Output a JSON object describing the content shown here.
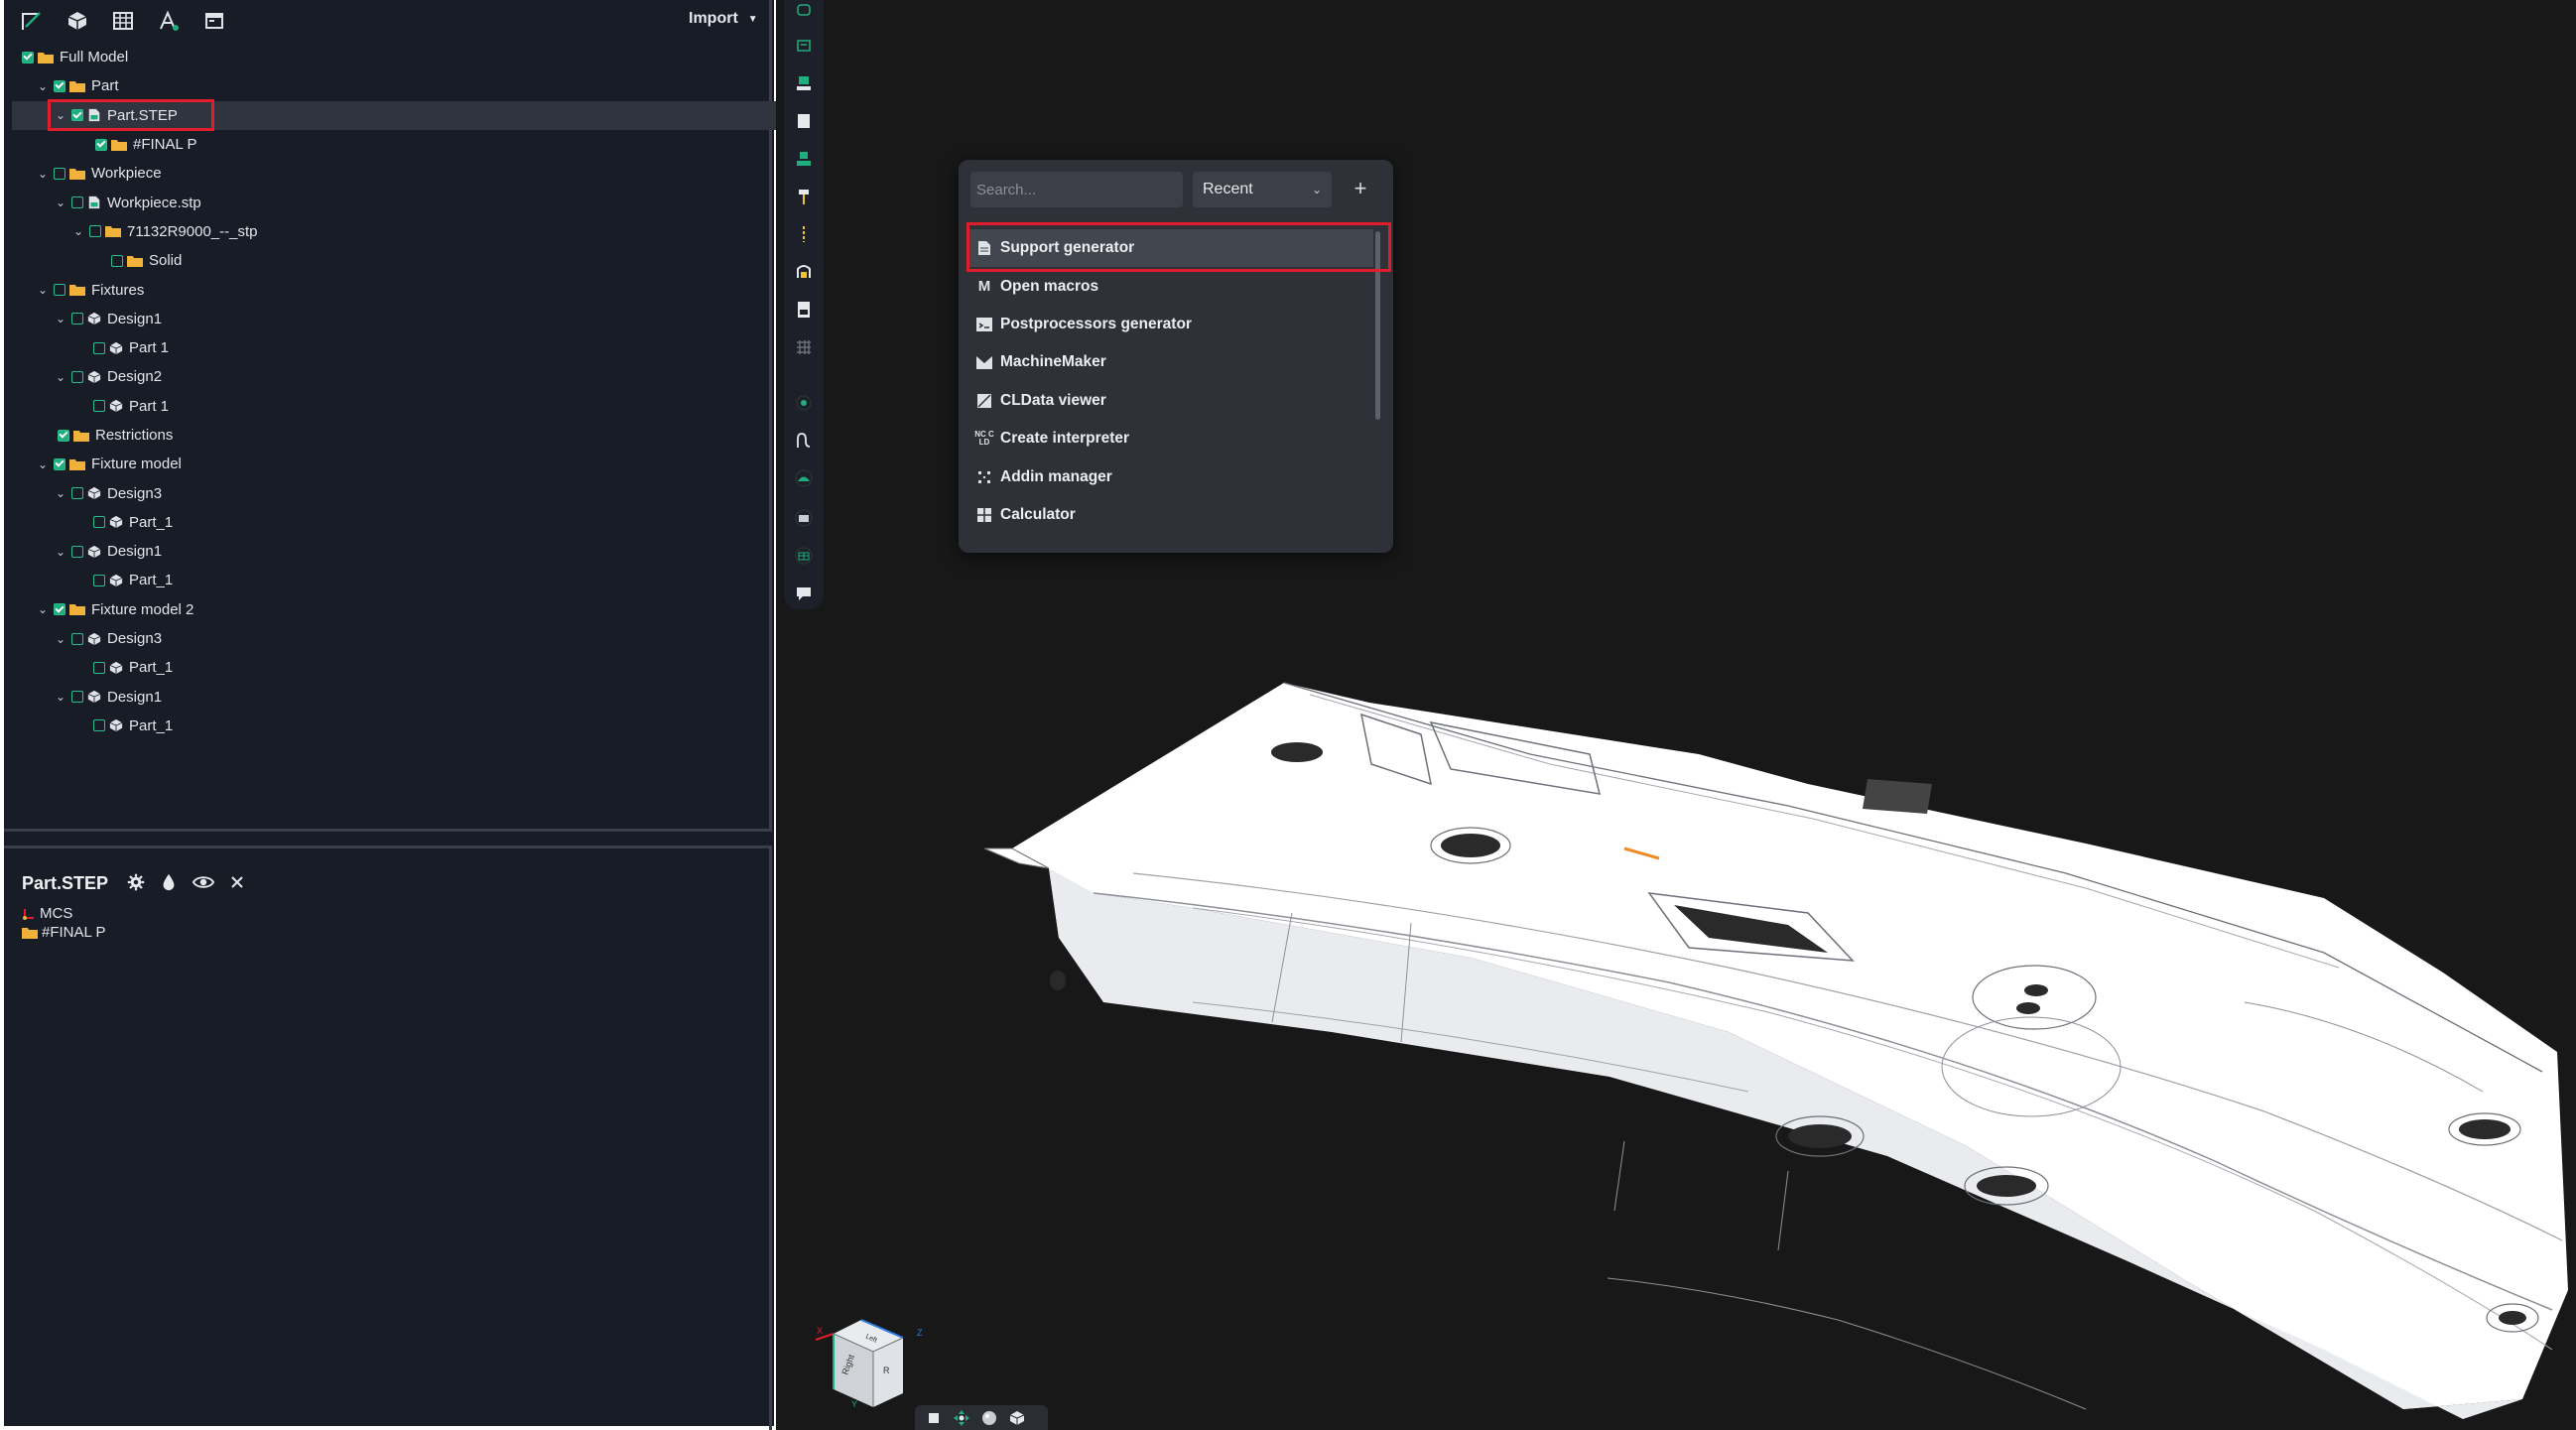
{
  "toolbar": {
    "icons": [
      "sketch-icon",
      "solid-icon",
      "table-icon",
      "text-geometry-icon",
      "window-icon"
    ],
    "import_label": "Import"
  },
  "tree": {
    "nodes": [
      {
        "label": "Full Model",
        "checked": true,
        "icon": "folder"
      },
      {
        "label": "Part",
        "checked": true,
        "icon": "folder"
      },
      {
        "label": "Part.STEP",
        "checked": true,
        "icon": "step-file",
        "selected": true
      },
      {
        "label": "#FINAL P",
        "checked": true,
        "icon": "folder"
      },
      {
        "label": "Workpiece",
        "checked": false,
        "icon": "folder"
      },
      {
        "label": "Workpiece.stp",
        "checked": false,
        "icon": "step-file"
      },
      {
        "label": "71132R9000_--_stp",
        "checked": false,
        "icon": "folder"
      },
      {
        "label": "Solid",
        "checked": false,
        "icon": "folder"
      },
      {
        "label": "Fixtures",
        "checked": false,
        "icon": "folder"
      },
      {
        "label": "Design1",
        "checked": false,
        "icon": "body"
      },
      {
        "label": "Part 1",
        "checked": false,
        "icon": "body"
      },
      {
        "label": "Design2",
        "checked": false,
        "icon": "body"
      },
      {
        "label": "Part 1",
        "checked": false,
        "icon": "body"
      },
      {
        "label": "Restrictions",
        "checked": true,
        "icon": "folder"
      },
      {
        "label": "Fixture model",
        "checked": true,
        "icon": "folder"
      },
      {
        "label": "Design3",
        "checked": false,
        "icon": "body"
      },
      {
        "label": "Part_1",
        "checked": false,
        "icon": "body"
      },
      {
        "label": "Design1",
        "checked": false,
        "icon": "body"
      },
      {
        "label": "Part_1",
        "checked": false,
        "icon": "body"
      },
      {
        "label": "Fixture model 2",
        "checked": true,
        "icon": "folder"
      },
      {
        "label": "Design3",
        "checked": false,
        "icon": "body"
      },
      {
        "label": "Part_1",
        "checked": false,
        "icon": "body"
      },
      {
        "label": "Design1",
        "checked": false,
        "icon": "body"
      },
      {
        "label": "Part_1",
        "checked": false,
        "icon": "body"
      }
    ]
  },
  "properties": {
    "title": "Part.STEP",
    "items": [
      {
        "label": "MCS",
        "icon": "axis-icon"
      },
      {
        "label": "#FINAL P",
        "icon": "folder-icon"
      }
    ]
  },
  "popup": {
    "search_placeholder": "Search...",
    "filter_value": "Recent",
    "add_label": "+",
    "items": [
      {
        "label": "Support generator",
        "icon": "document-icon",
        "active": true
      },
      {
        "label": "Open macros",
        "icon": "macro-m-icon",
        "glyph": "M"
      },
      {
        "label": "Postprocessors generator",
        "icon": "code-window-icon"
      },
      {
        "label": "MachineMaker",
        "icon": "machine-icon"
      },
      {
        "label": "CLData viewer",
        "icon": "cldata-icon"
      },
      {
        "label": "Create interpreter",
        "icon": "nc-cld-icon",
        "glyph": "NC CLD"
      },
      {
        "label": "Addin manager",
        "icon": "addin-icon"
      },
      {
        "label": "Calculator",
        "icon": "calculator-icon"
      }
    ]
  },
  "viewcube": {
    "front": "Right",
    "top": "Left",
    "side": "R",
    "axes": [
      "X",
      "Y",
      "Z"
    ]
  },
  "colors": {
    "accent": "#1fae7d",
    "highlight": "#e11d2b",
    "panel_bg": "#181c27",
    "viewport_bg": "#181818",
    "popup_bg": "#2e3138"
  }
}
